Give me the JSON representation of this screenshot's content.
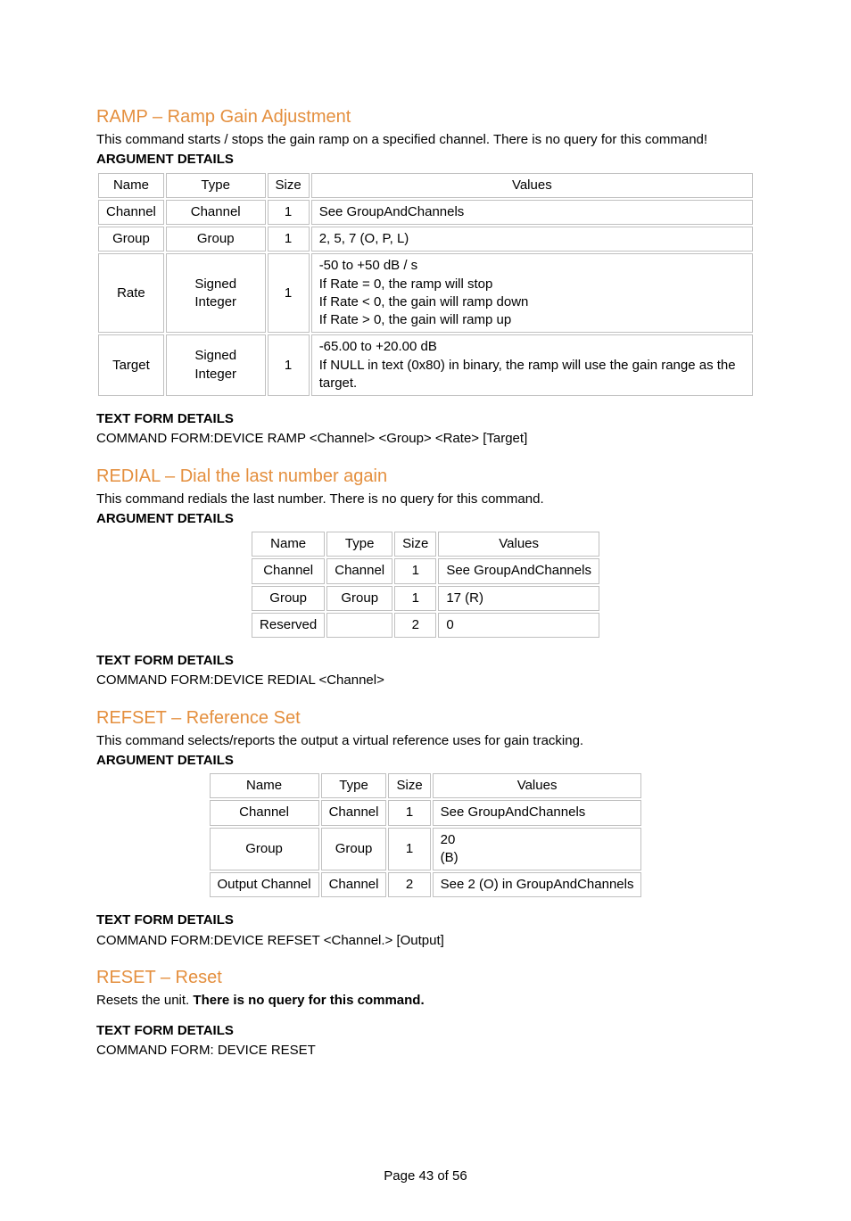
{
  "sections": [
    {
      "title": "RAMP – Ramp Gain Adjustment",
      "desc_parts": [
        {
          "text": "This command starts / stops the gain ramp on a specified channel. There is no query for this command!",
          "bold": false
        }
      ],
      "arg_header": "ARGUMENT DETAILS",
      "table": {
        "headers": [
          "Name",
          "Type",
          "Size",
          "Values"
        ],
        "rows": [
          [
            "Channel",
            "Channel",
            "1",
            "See GroupAndChannels"
          ],
          [
            "Group",
            "Group",
            "1",
            "2, 5, 7 (O, P, L)"
          ],
          [
            "Rate",
            "Signed Integer",
            "1",
            "-50 to +50 dB / s\nIf Rate = 0, the ramp will stop\nIf Rate < 0, the gain will ramp down\nIf Rate > 0, the gain will ramp up"
          ],
          [
            "Target",
            "Signed Integer",
            "1",
            "-65.00 to +20.00 dB\nIf NULL in text (0x80) in binary, the ramp will use the gain range as the target."
          ]
        ]
      },
      "tf_header": "TEXT FORM DETAILS",
      "tf_body": "COMMAND FORM:DEVICE RAMP <Channel> <Group> <Rate> [Target]"
    },
    {
      "title": "REDIAL – Dial the last number again",
      "desc_parts": [
        {
          "text": "This command redials the last number. There is no query for this command.",
          "bold": false
        }
      ],
      "arg_header": "ARGUMENT DETAILS",
      "table": {
        "headers": [
          "Name",
          "Type",
          "Size",
          "Values"
        ],
        "rows": [
          [
            "Channel",
            "Channel",
            "1",
            "See GroupAndChannels"
          ],
          [
            "Group",
            "Group",
            "1",
            "17 (R)"
          ],
          [
            "Reserved",
            "",
            "2",
            "0"
          ]
        ]
      },
      "tf_header": "TEXT FORM DETAILS",
      "tf_body": "COMMAND FORM:DEVICE REDIAL <Channel>"
    },
    {
      "title": "REFSET – Reference Set",
      "desc_parts": [
        {
          "text": "This command selects/reports the output a virtual reference uses for gain tracking.",
          "bold": false
        }
      ],
      "arg_header": "ARGUMENT DETAILS",
      "table": {
        "headers": [
          "Name",
          "Type",
          "Size",
          "Values"
        ],
        "rows": [
          [
            "Channel",
            "Channel",
            "1",
            "See GroupAndChannels"
          ],
          [
            "Group",
            "Group",
            "1",
            "20\n(B)"
          ],
          [
            "Output Channel",
            "Channel",
            "2",
            "See 2 (O) in GroupAndChannels"
          ]
        ]
      },
      "tf_header": "TEXT FORM DETAILS",
      "tf_body": "COMMAND FORM:DEVICE REFSET <Channel.> [Output]"
    },
    {
      "title": "RESET – Reset",
      "desc_parts": [
        {
          "text": "Resets the unit. ",
          "bold": false
        },
        {
          "text": "There is no query for this command.",
          "bold": true
        }
      ],
      "arg_header": null,
      "table": null,
      "tf_header": "TEXT FORM DETAILS",
      "tf_body": "COMMAND FORM: DEVICE RESET"
    }
  ],
  "footer": "Page 43 of 56"
}
